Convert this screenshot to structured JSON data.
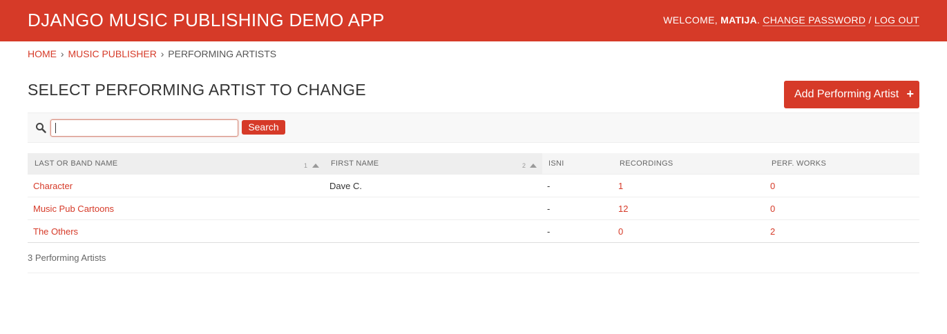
{
  "header": {
    "branding": "DJANGO MUSIC PUBLISHING DEMO APP",
    "welcome_prefix": "WELCOME, ",
    "username": "MATIJA",
    "welcome_suffix": ". ",
    "change_password": "CHANGE PASSWORD",
    "separator": " / ",
    "log_out": "LOG OUT"
  },
  "breadcrumbs": {
    "home": "HOME",
    "sep1": "›",
    "app": "MUSIC PUBLISHER",
    "sep2": "›",
    "current": "PERFORMING ARTISTS"
  },
  "page_title": "SELECT PERFORMING ARTIST TO CHANGE",
  "add_button": {
    "label": "Add Performing Artist",
    "icon": "+"
  },
  "search": {
    "value": "",
    "placeholder": "",
    "button_label": "Search",
    "icon": "search-icon"
  },
  "table": {
    "columns": [
      {
        "label": "LAST OR BAND NAME",
        "sort_priority": "1",
        "sorted": "ascending"
      },
      {
        "label": "FIRST NAME",
        "sort_priority": "2",
        "sorted": "ascending"
      },
      {
        "label": "ISNI"
      },
      {
        "label": "RECORDINGS"
      },
      {
        "label": "PERF. WORKS"
      }
    ],
    "rows": [
      {
        "name": "Character",
        "first_name": "Dave C.",
        "isni": "-",
        "recordings": "1",
        "perf_works": "0"
      },
      {
        "name": "Music Pub Cartoons",
        "first_name": "",
        "isni": "-",
        "recordings": "12",
        "perf_works": "0"
      },
      {
        "name": "The Others",
        "first_name": "",
        "isni": "-",
        "recordings": "0",
        "perf_works": "2"
      }
    ]
  },
  "paginator": "3 Performing Artists",
  "colors": {
    "accent": "#d63a28",
    "header_bg": "#d63a28",
    "table_header_bg": "#f5f5f5"
  }
}
